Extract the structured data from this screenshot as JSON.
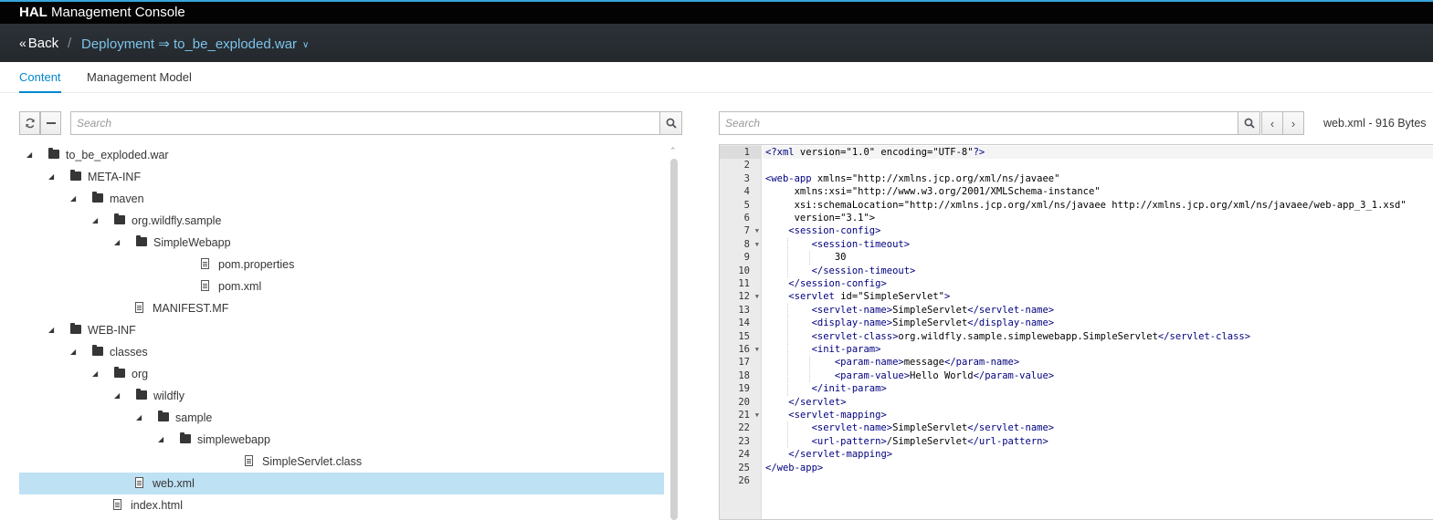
{
  "app": {
    "brand_bold": "HAL",
    "brand_rest": "Management Console"
  },
  "breadcrumb": {
    "back_label": "Back",
    "separator": "/",
    "path": "Deployment ⇒ to_be_exploded.war"
  },
  "tabs": [
    {
      "label": "Content",
      "active": true
    },
    {
      "label": "Management Model",
      "active": false
    }
  ],
  "left": {
    "search_placeholder": "Search",
    "tree": [
      {
        "label": "to_be_exploded.war",
        "type": "folder",
        "depth": 0,
        "expanded": true
      },
      {
        "label": "META-INF",
        "type": "folder",
        "depth": 1,
        "expanded": true
      },
      {
        "label": "maven",
        "type": "folder",
        "depth": 2,
        "expanded": true
      },
      {
        "label": "org.wildfly.sample",
        "type": "folder",
        "depth": 3,
        "expanded": true
      },
      {
        "label": "SimpleWebapp",
        "type": "folder",
        "depth": 4,
        "expanded": true
      },
      {
        "label": "pom.properties",
        "type": "file",
        "depth": 5
      },
      {
        "label": "pom.xml",
        "type": "file",
        "depth": 5
      },
      {
        "label": "MANIFEST.MF",
        "type": "file",
        "depth": 2
      },
      {
        "label": "WEB-INF",
        "type": "folder",
        "depth": 1,
        "expanded": true
      },
      {
        "label": "classes",
        "type": "folder",
        "depth": 2,
        "expanded": true
      },
      {
        "label": "org",
        "type": "folder",
        "depth": 3,
        "expanded": true
      },
      {
        "label": "wildfly",
        "type": "folder",
        "depth": 4,
        "expanded": true
      },
      {
        "label": "sample",
        "type": "folder",
        "depth": 5,
        "expanded": true
      },
      {
        "label": "simplewebapp",
        "type": "folder",
        "depth": 6,
        "expanded": true
      },
      {
        "label": "SimpleServlet.class",
        "type": "file",
        "depth": 7
      },
      {
        "label": "web.xml",
        "type": "file",
        "depth": 2,
        "selected": true
      },
      {
        "label": "index.html",
        "type": "file",
        "depth": 1
      }
    ]
  },
  "right": {
    "search_placeholder": "Search",
    "file_info": "web.xml - 916 Bytes",
    "code_lines": [
      "<?xml version=\"1.0\" encoding=\"UTF-8\"?>",
      "",
      "<web-app xmlns=\"http://xmlns.jcp.org/xml/ns/javaee\"",
      "     xmlns:xsi=\"http://www.w3.org/2001/XMLSchema-instance\"",
      "     xsi:schemaLocation=\"http://xmlns.jcp.org/xml/ns/javaee http://xmlns.jcp.org/xml/ns/javaee/web-app_3_1.xsd\"",
      "     version=\"3.1\">",
      "    <session-config>",
      "        <session-timeout>",
      "            30",
      "        </session-timeout>",
      "    </session-config>",
      "    <servlet id=\"SimpleServlet\">",
      "        <servlet-name>SimpleServlet</servlet-name>",
      "        <display-name>SimpleServlet</display-name>",
      "        <servlet-class>org.wildfly.sample.simplewebapp.SimpleServlet</servlet-class>",
      "        <init-param>",
      "            <param-name>message</param-name>",
      "            <param-value>Hello World</param-value>",
      "        </init-param>",
      "    </servlet>",
      "    <servlet-mapping>",
      "        <servlet-name>SimpleServlet</servlet-name>",
      "        <url-pattern>/SimpleServlet</url-pattern>",
      "    </servlet-mapping>",
      "</web-app>",
      ""
    ],
    "fold_lines": [
      7,
      8,
      12,
      16,
      21
    ]
  }
}
